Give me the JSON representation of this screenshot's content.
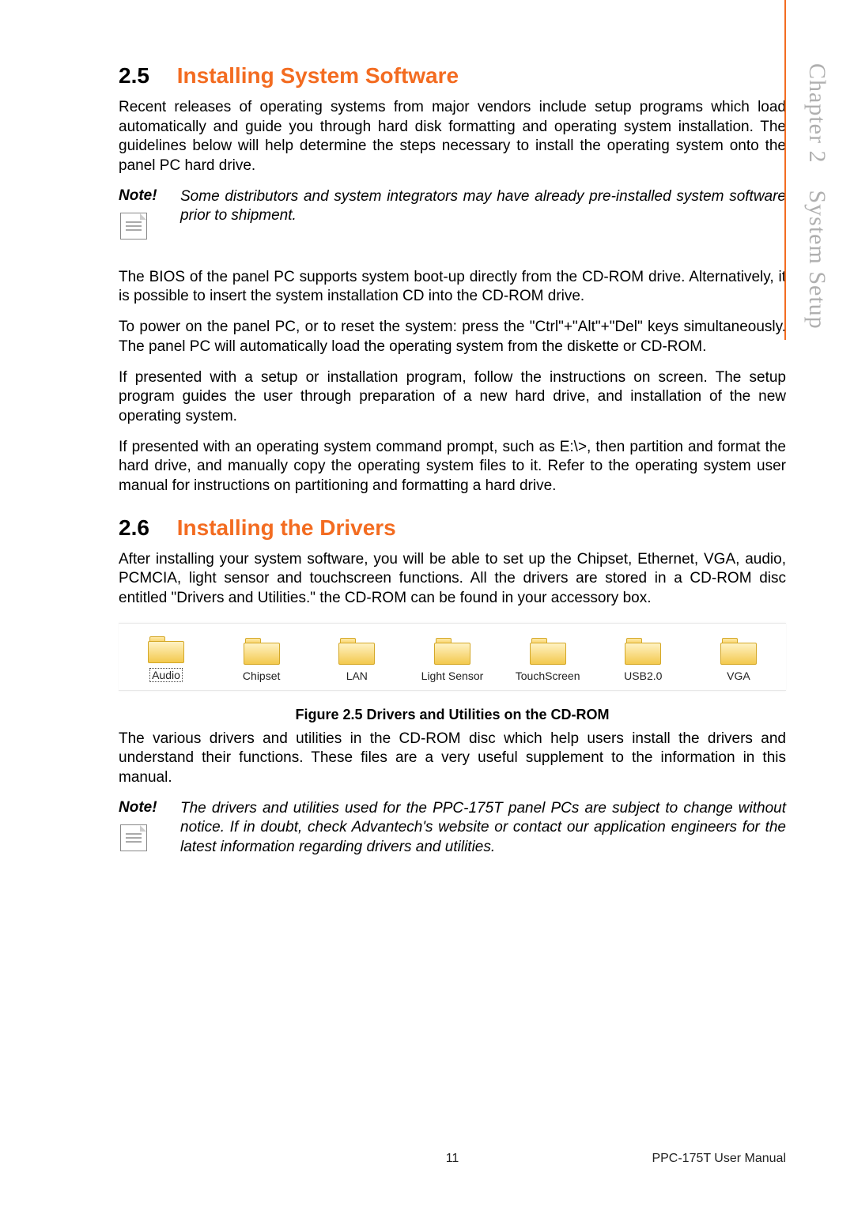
{
  "sidebar": {
    "chapter_label": "Chapter 2",
    "section_label": "System Setup"
  },
  "sections": {
    "s25": {
      "num": "2.5",
      "title": "Installing System Software",
      "intro": "Recent releases of operating systems from major vendors include setup programs which load automatically and guide you through hard disk formatting and operating system installation. The guidelines below will help determine the steps necessary to install the operating system onto the panel PC hard drive.",
      "note_label": "Note!",
      "note_text": "Some distributors and system integrators may have already pre-installed system software prior to shipment.",
      "p1": "The BIOS of the panel PC supports system boot-up directly from the CD-ROM drive. Alternatively, it is possible to insert the system installation CD into the CD-ROM drive.",
      "p2": "To power on the panel PC, or to reset the system: press the \"Ctrl\"+\"Alt\"+\"Del\" keys simultaneously. The panel PC will automatically load the operating system from the diskette or CD-ROM.",
      "p3": "If presented with a setup or installation program, follow the instructions on screen. The setup program guides the user through preparation of a new hard drive, and installation of the new operating system.",
      "p4": "If presented with an operating system command prompt, such as E:\\>, then partition and format the hard drive, and manually copy the operating system files to it. Refer to the operating system user manual for instructions on partitioning and formatting a hard drive."
    },
    "s26": {
      "num": "2.6",
      "title": "Installing the Drivers",
      "intro": "After installing your system software, you will be able to set up the Chipset, Ethernet, VGA, audio, PCMCIA, light sensor and touchscreen functions. All the drivers are stored in a CD-ROM disc entitled \"Drivers and Utilities.\"  the CD-ROM can be found in your accessory box.",
      "folders": [
        {
          "label": "Audio",
          "selected": true
        },
        {
          "label": "Chipset",
          "selected": false
        },
        {
          "label": "LAN",
          "selected": false
        },
        {
          "label": "Light Sensor",
          "selected": false
        },
        {
          "label": "TouchScreen",
          "selected": false
        },
        {
          "label": "USB2.0",
          "selected": false
        },
        {
          "label": "VGA",
          "selected": false
        }
      ],
      "figure_caption": "Figure 2.5 Drivers and Utilities on the CD-ROM",
      "after_fig": "The various drivers and utilities in the CD-ROM disc which help users install the drivers and understand their functions. These files are a very useful supplement to the information in this manual.",
      "note_label": "Note!",
      "note_text": "The drivers and utilities used for the PPC-175T panel PCs are subject to change without notice. If in doubt, check Advantech's website or contact our application engineers for the latest information regarding drivers and utilities."
    }
  },
  "footer": {
    "page_number": "11",
    "doc_title": "PPC-175T User Manual"
  }
}
